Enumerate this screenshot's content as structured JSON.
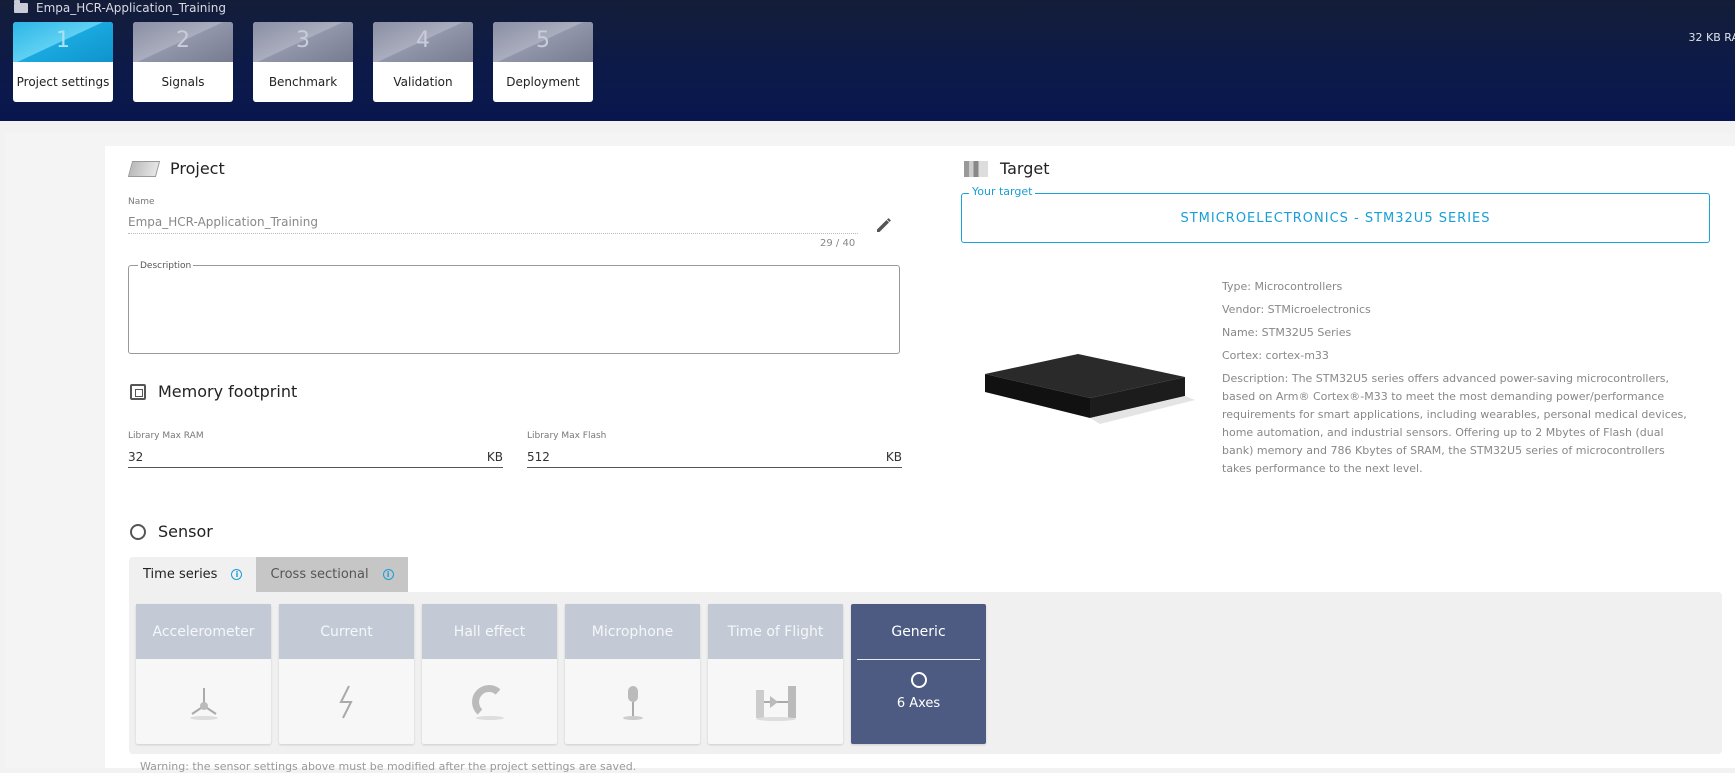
{
  "breadcrumb": {
    "project": "Empa_HCR-Application_Training"
  },
  "steps": [
    {
      "num": "1",
      "label": "Project settings"
    },
    {
      "num": "2",
      "label": "Signals"
    },
    {
      "num": "3",
      "label": "Benchmark"
    },
    {
      "num": "4",
      "label": "Validation"
    },
    {
      "num": "5",
      "label": "Deployment"
    }
  ],
  "header": {
    "ram": "32 KB RA"
  },
  "project": {
    "title": "Project",
    "name_label": "Name",
    "name_value": "Empa_HCR-Application_Training",
    "counter": "29 / 40",
    "description_label": "Description",
    "description_value": ""
  },
  "memory": {
    "title": "Memory footprint",
    "ram_label": "Library Max RAM",
    "ram_value": "32",
    "ram_unit": "KB",
    "flash_label": "Library Max Flash",
    "flash_value": "512",
    "flash_unit": "KB"
  },
  "target": {
    "title": "Target",
    "legend": "Your target",
    "value": "STMICROELECTRONICS - STM32U5 SERIES",
    "type": "Type: Microcontrollers",
    "vendor": "Vendor: STMicroelectronics",
    "name": "Name: STM32U5 Series",
    "cortex": "Cortex: cortex-m33",
    "description": "Description: The STM32U5 series offers advanced power-saving microcontrollers, based on Arm® Cortex®-M33 to meet the most demanding power/performance requirements for smart applications, including wearables, personal medical devices, home automation, and industrial sensors. Offering up to 2 Mbytes of Flash (dual bank) memory and 786 Kbytes of SRAM, the STM32U5 series of microcontrollers takes performance to the next level."
  },
  "sensor": {
    "title": "Sensor",
    "tabs": [
      {
        "label": "Time series"
      },
      {
        "label": "Cross sectional"
      }
    ],
    "tiles": [
      {
        "label": "Accelerometer",
        "icon": "accelerometer-icon"
      },
      {
        "label": "Current",
        "icon": "current-icon"
      },
      {
        "label": "Hall effect",
        "icon": "magnet-icon"
      },
      {
        "label": "Microphone",
        "icon": "microphone-icon"
      },
      {
        "label": "Time of Flight",
        "icon": "time-of-flight-icon"
      },
      {
        "label": "Generic",
        "icon": "generic-sensor-icon",
        "axes": "6 Axes"
      }
    ],
    "warning": "Warning: the sensor settings above must be modified after the project settings are saved."
  }
}
